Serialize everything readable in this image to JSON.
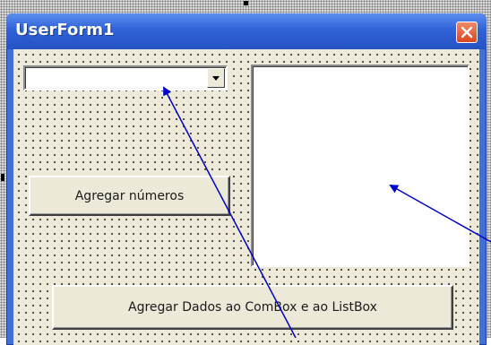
{
  "window": {
    "title": "UserForm1",
    "close_icon": "close-icon",
    "title_color": "#2f62d6",
    "close_color": "#d9461f"
  },
  "form": {
    "combobox": {
      "value": "",
      "dropdown_icon": "chevron-down-icon"
    },
    "listbox": {
      "items": []
    },
    "buttons": {
      "add_numbers": "Agregar números",
      "add_data": "Agregar Dados ao ComBox e ao ListBox"
    }
  },
  "annotations": {
    "arrow_color": "#0000cc"
  }
}
